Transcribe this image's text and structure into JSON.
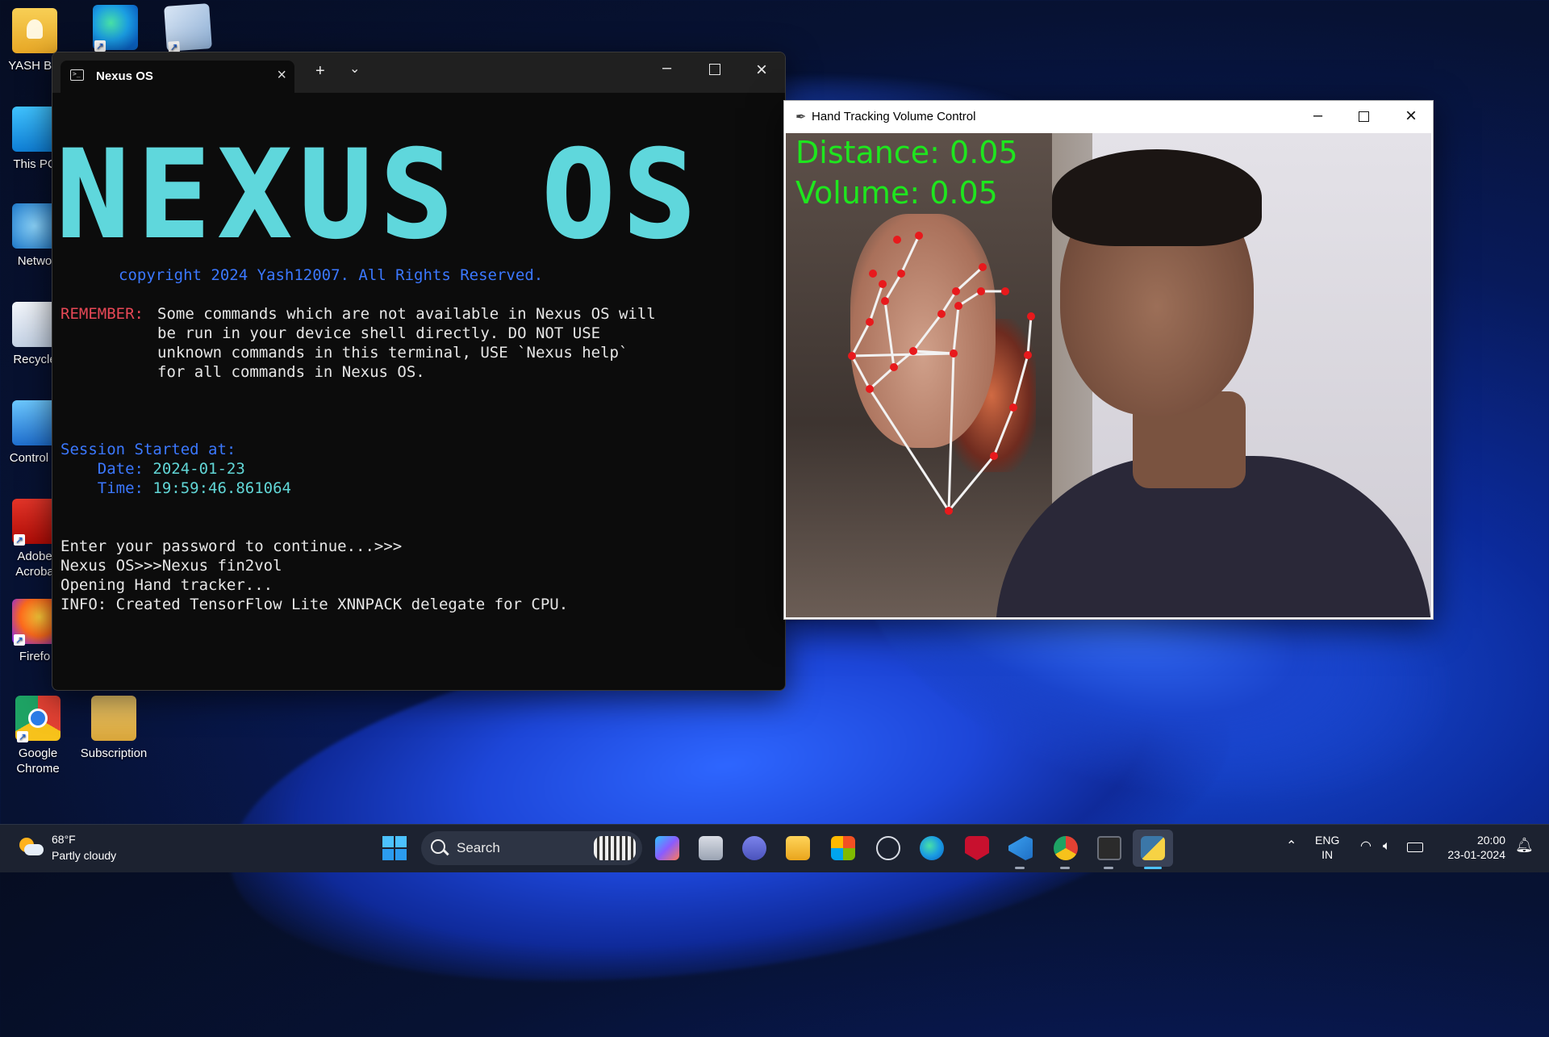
{
  "desktop": {
    "icons": [
      {
        "label": "YASH BO",
        "icon": "user-folder-icon"
      },
      {
        "label": "",
        "icon": "edge-icon"
      },
      {
        "label": "",
        "icon": "virtualbox-icon"
      },
      {
        "label": "This PC",
        "icon": "computer-icon"
      },
      {
        "label": "Netwo",
        "icon": "network-icon"
      },
      {
        "label": "Recycle",
        "icon": "recycle-bin-icon"
      },
      {
        "label": "Control P",
        "icon": "control-panel-icon"
      },
      {
        "label": "Adobe Acroba",
        "icon": "acrobat-icon"
      },
      {
        "label": "Firefo",
        "icon": "firefox-icon"
      },
      {
        "label": "Google Chrome",
        "icon": "chrome-icon"
      },
      {
        "label": "Subscription",
        "icon": "folder-icon"
      }
    ]
  },
  "terminal": {
    "tab_title": "Nexus OS",
    "banner": "NEXUS OS",
    "copyright": "copyright 2024 Yash12007. All Rights Reserved.",
    "remember_label": "REMEMBER:",
    "remember_lines": [
      "Some commands which are not available in Nexus OS will",
      "be run in your device shell directly. DO NOT USE",
      "unknown commands in this terminal, USE `Nexus help`",
      "for all commands in Nexus OS."
    ],
    "session_label": "Session Started at:",
    "date_label": "    Date: ",
    "date_value": "2024-01-23",
    "time_label": "    Time: ",
    "time_value": "19:59:46.861064",
    "output_lines": [
      "Enter your password to continue...>>>",
      "Nexus OS>>>Nexus fin2vol",
      "Opening Hand tracker...",
      "INFO: Created TensorFlow Lite XNNPACK delegate for CPU."
    ],
    "colors": {
      "banner": "#5fd7dc",
      "blue": "#3b78ff",
      "red": "#e74856",
      "cyan": "#61d6d6"
    }
  },
  "hand_window": {
    "title": "Hand Tracking Volume Control",
    "distance_text": "Distance: 0.05",
    "volume_text": "Volume: 0.05",
    "overlay_color": "#1ee61e",
    "landmark_color": "#e8191c"
  },
  "taskbar": {
    "weather_temp": "68°F",
    "weather_desc": "Partly cloudy",
    "search_label": "Search",
    "lang_top": "ENG",
    "lang_bottom": "IN",
    "clock_time": "20:00",
    "clock_date": "23-01-2024"
  }
}
